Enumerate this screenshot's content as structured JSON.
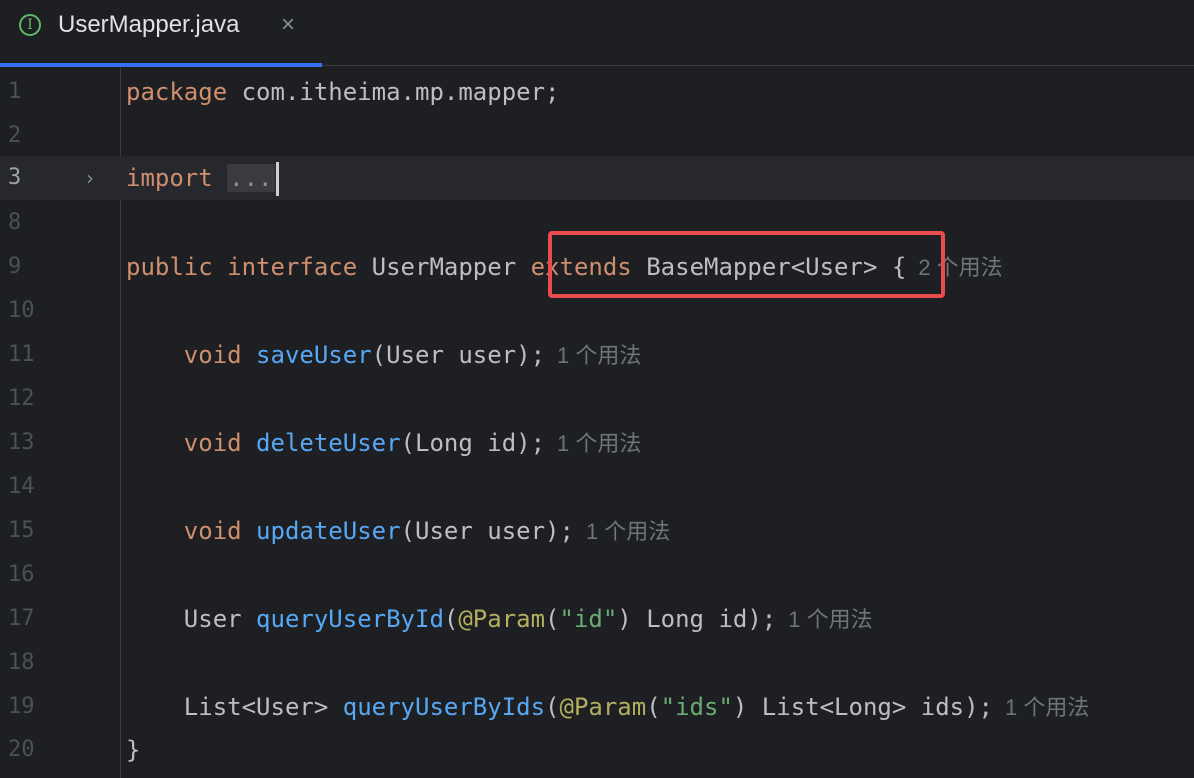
{
  "tab": {
    "icon_glyph": "I",
    "icon": "interface-icon",
    "title": "UserMapper.java",
    "close_glyph": "×"
  },
  "lines": {
    "l1": {
      "num": "1",
      "kw": "package",
      "rest": " com.itheima.mp.mapper;"
    },
    "l2": {
      "num": "2"
    },
    "l3": {
      "num": "3",
      "fold": "›",
      "kw": "import",
      "ellipsis": "..."
    },
    "l8": {
      "num": "8"
    },
    "l9": {
      "num": "9",
      "kw1": "public",
      "kw2": "interface",
      "name": "UserMapper",
      "kw3": "extends",
      "type": "BaseMapper<User>",
      "brace": "{",
      "hint": "2 个用法"
    },
    "l10": {
      "num": "10"
    },
    "l11": {
      "num": "11",
      "kw": "void",
      "fn": "saveUser",
      "args": "(User user);",
      "hint": "1 个用法"
    },
    "l12": {
      "num": "12"
    },
    "l13": {
      "num": "13",
      "kw": "void",
      "fn": "deleteUser",
      "args": "(Long id);",
      "hint": "1 个用法"
    },
    "l14": {
      "num": "14"
    },
    "l15": {
      "num": "15",
      "kw": "void",
      "fn": "updateUser",
      "args": "(User user);",
      "hint": "1 个用法"
    },
    "l16": {
      "num": "16"
    },
    "l17": {
      "num": "17",
      "ret": "User",
      "fn": "queryUserById",
      "p_open": "(",
      "ann": "@Param",
      "a_open": "(",
      "str": "\"id\"",
      "a_close": ")",
      "rest": " Long id);",
      "hint": "1 个用法"
    },
    "l18": {
      "num": "18"
    },
    "l19": {
      "num": "19",
      "ret": "List<User>",
      "fn": "queryUserByIds",
      "p_open": "(",
      "ann": "@Param",
      "a_open": "(",
      "str": "\"ids\"",
      "a_close": ")",
      "rest": " List<Long> ids);",
      "hint": "1 个用法"
    },
    "l20": {
      "num": "20",
      "brace": "}"
    }
  },
  "colors": {
    "background": "#1e1f22",
    "keyword": "#cf8e6d",
    "method": "#56a8f5",
    "annotation": "#b3ae60",
    "string": "#6aab73",
    "highlight_box": "#e84c4c",
    "tab_accent": "#3574f0"
  }
}
